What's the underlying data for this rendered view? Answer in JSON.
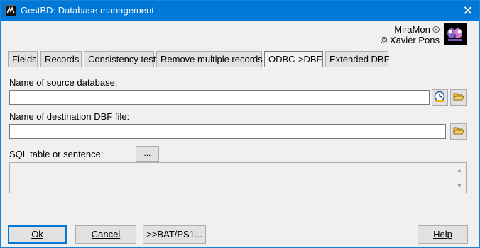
{
  "window": {
    "title": "GestBD: Database management",
    "close_glyph": "✕"
  },
  "brand": {
    "line1": "MiraMon ®",
    "line2": "© Xavier Pons"
  },
  "tabs": [
    {
      "label": "Fields",
      "active": false
    },
    {
      "label": "Records",
      "active": false
    },
    {
      "label": "Consistency test",
      "active": false
    },
    {
      "label": "Remove multiple records",
      "active": false
    },
    {
      "label": "ODBC->DBF",
      "active": true
    },
    {
      "label": "Extended DBF",
      "active": false
    }
  ],
  "form": {
    "source_label": "Name of source database:",
    "source_value": "",
    "dest_label": "Name of destination DBF file:",
    "dest_value": "",
    "sql_label": "SQL table or sentence:",
    "sql_value": "",
    "ellipsis_label": "..."
  },
  "buttons": {
    "ok": "Ok",
    "cancel": "Cancel",
    "bat": ">>BAT/PS1...",
    "help": "Help"
  },
  "icons": {
    "app": "miramon-app-icon",
    "odbc": "odbc-datasource-icon",
    "folder": "folder-open-icon",
    "logo": "miramon-logo"
  },
  "colors": {
    "titlebar": "#0078d7",
    "folder": "#e8b130"
  }
}
